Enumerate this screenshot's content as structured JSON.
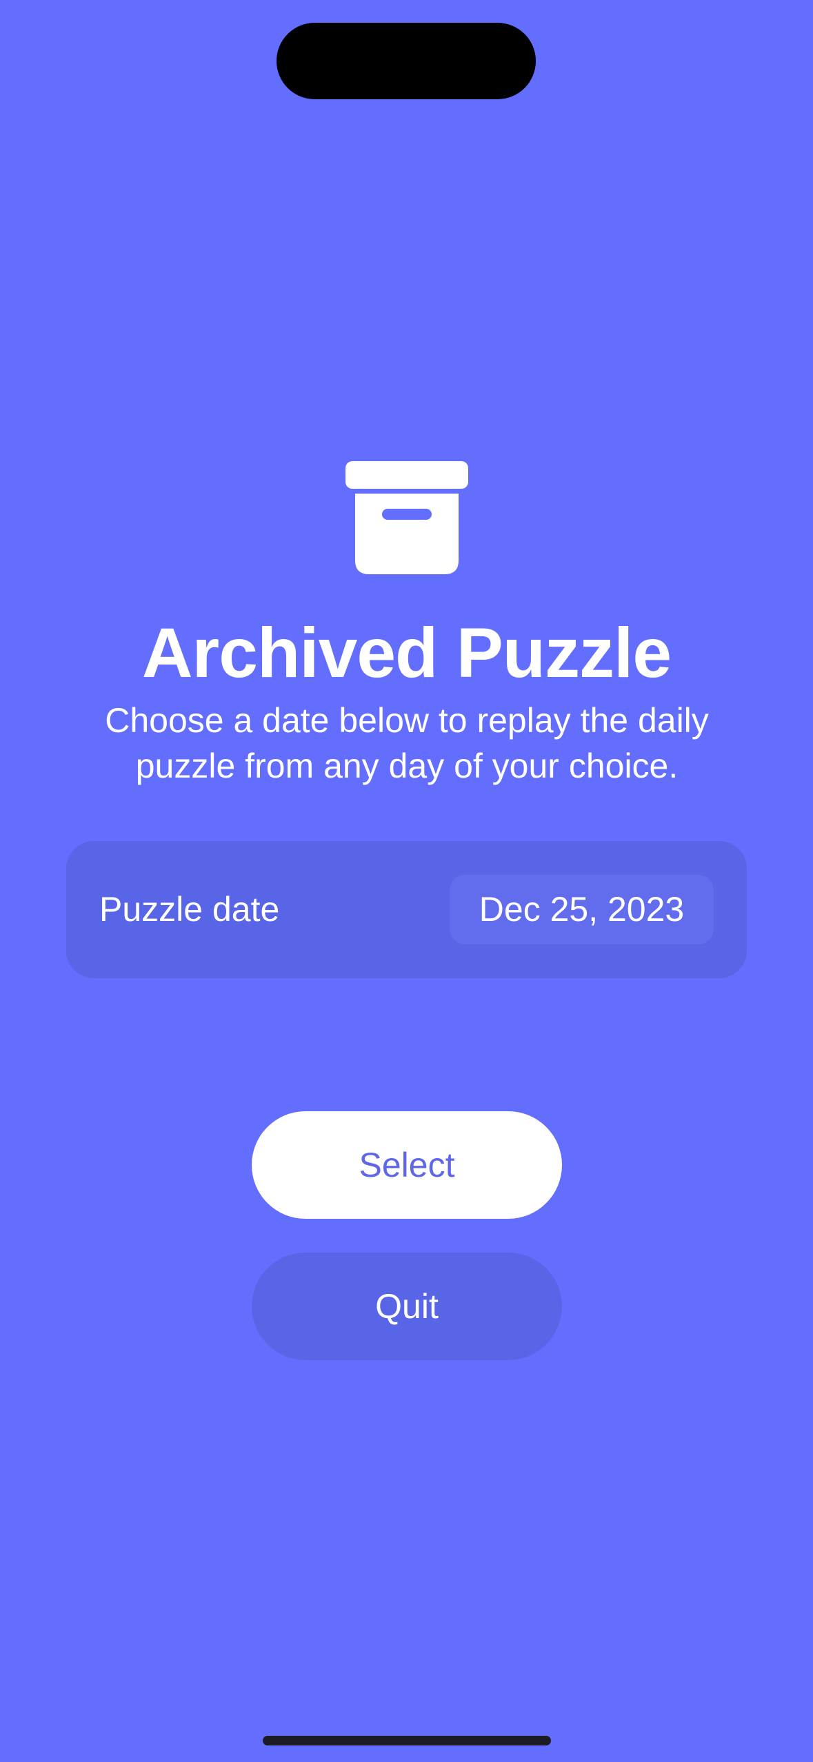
{
  "header": {
    "icon": "archive-box-icon",
    "title": "Archived Puzzle",
    "subtitle": "Choose a date below to replay the daily puzzle from any day of your choice."
  },
  "date_picker": {
    "label": "Puzzle date",
    "value": "Dec 25, 2023"
  },
  "actions": {
    "select_label": "Select",
    "quit_label": "Quit"
  },
  "colors": {
    "background": "#636EFF",
    "card": "#5865E6",
    "accent_text": "#5E67E8",
    "white": "#FFFFFF"
  }
}
